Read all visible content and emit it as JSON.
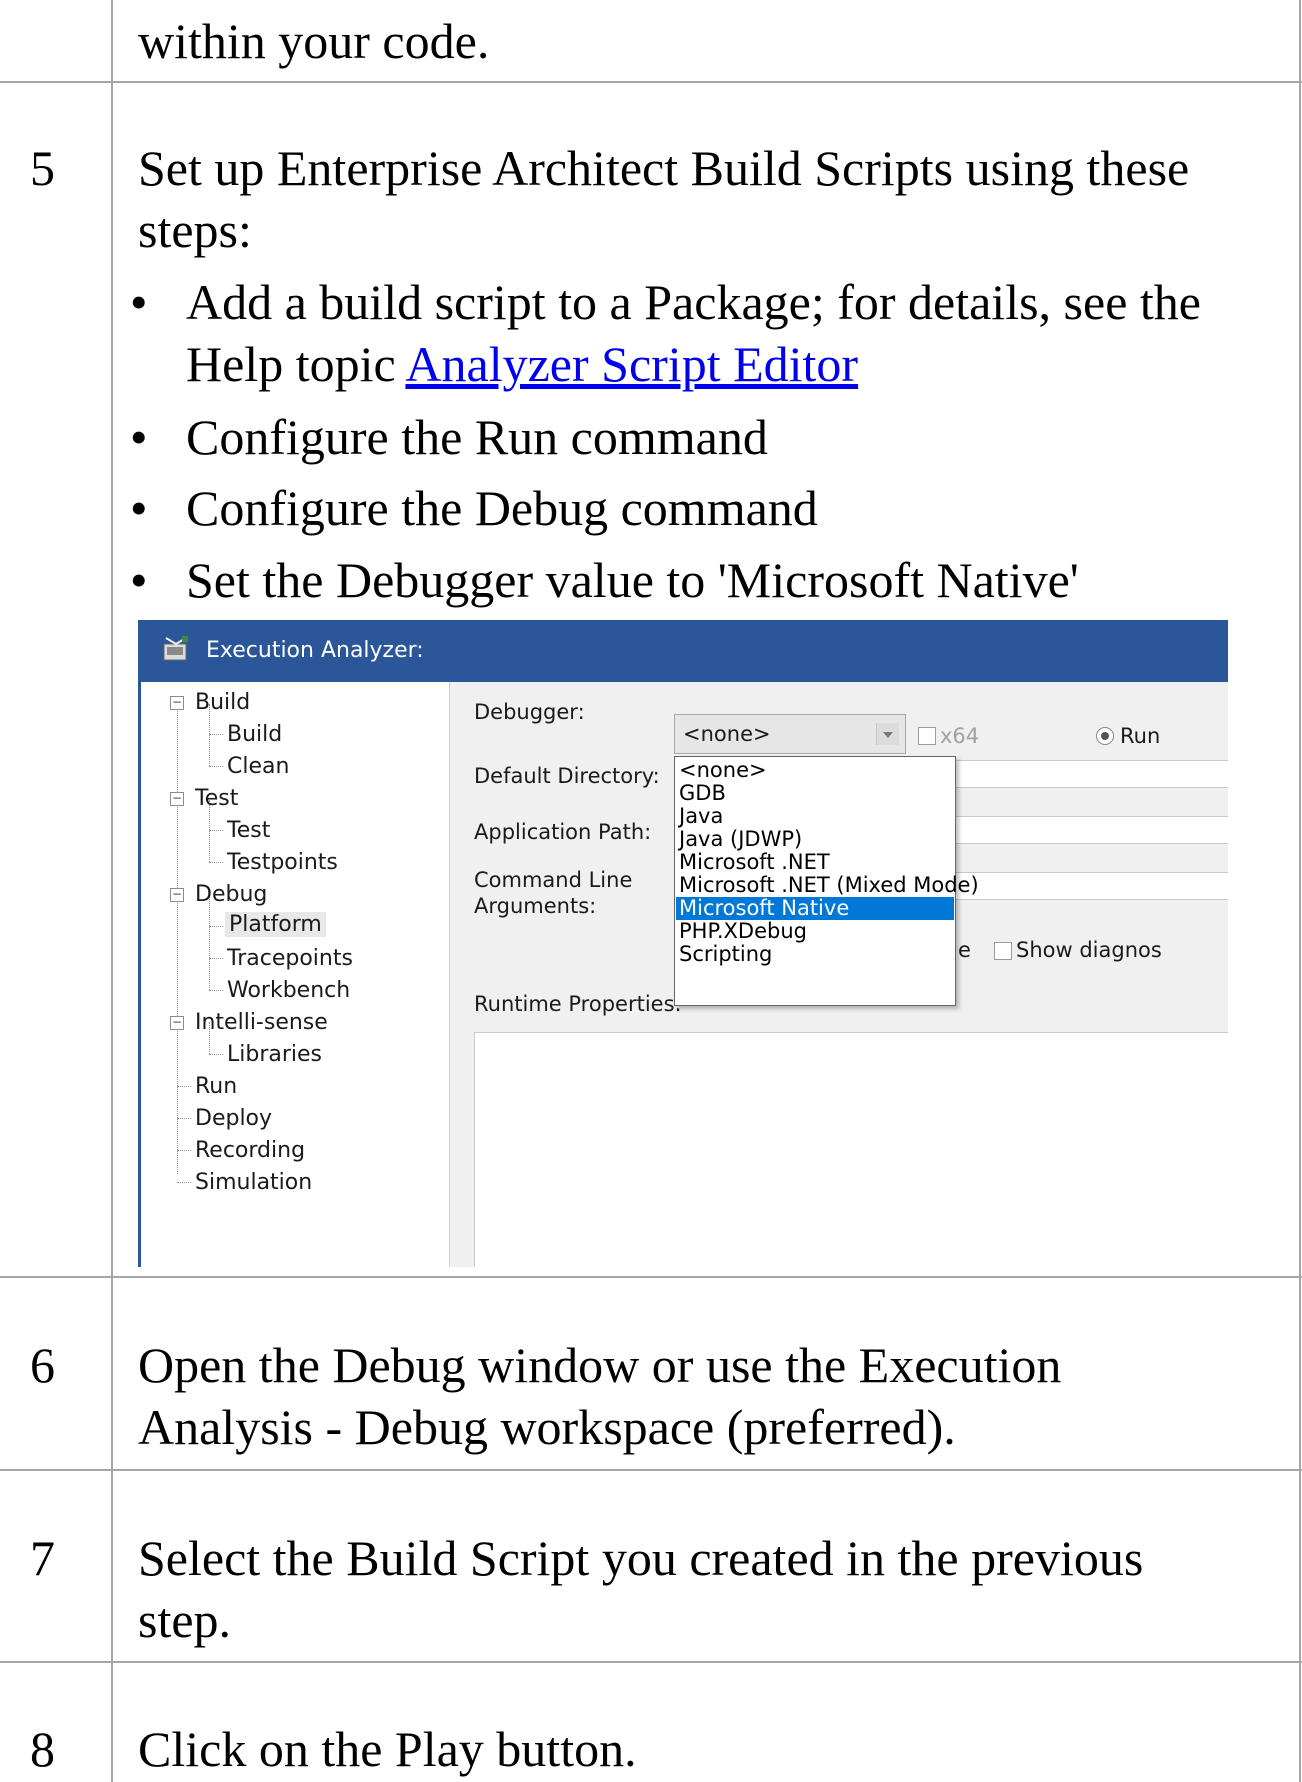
{
  "rows": [
    {
      "text_lines": [
        "within your code."
      ]
    },
    {
      "number": "5",
      "text_lines": [
        "Set up Enterprise Architect Build Scripts using these",
        "steps:"
      ],
      "bullets": [
        {
          "lines": [
            "Add a build script to a Package; for details, see the",
            "Help topic "
          ],
          "link": "Analyzer Script Editor"
        },
        {
          "lines": [
            "Configure the Run command"
          ]
        },
        {
          "lines": [
            "Configure the Debug command"
          ]
        },
        {
          "lines": [
            "Set the Debugger value to 'Microsoft Native'"
          ]
        }
      ]
    },
    {
      "number": "6",
      "text_lines": [
        "Open the Debug window or use the Execution",
        "Analysis - Debug workspace (preferred)."
      ]
    },
    {
      "number": "7",
      "text_lines": [
        "Select the Build Script you created in the previous",
        "step."
      ]
    },
    {
      "number": "8",
      "text_lines": [
        "Click on the Play button."
      ]
    }
  ],
  "screenshot": {
    "title": "Execution Analyzer:",
    "tree": [
      "Build",
      "Build",
      "Clean",
      "Test",
      "Test",
      "Testpoints",
      "Debug",
      "Platform",
      "Tracepoints",
      "Workbench",
      "Intelli-sense",
      "Libraries",
      "Run",
      "Deploy",
      "Recording",
      "Simulation"
    ],
    "labels": {
      "debugger": "Debugger:",
      "default_directory": "Default Directory:",
      "application_path": "Application Path:",
      "command_line_1": "Command Line",
      "command_line_2": "Arguments:",
      "runtime_properties": "Runtime Properties:",
      "x64": "x64",
      "run": "Run",
      "show_diagnostics": "Show diagnos",
      "partial_e": "e"
    },
    "debugger_value": "<none>",
    "dropdown_options": [
      "<none>",
      "GDB",
      "Java",
      "Java (JDWP)",
      "Microsoft .NET",
      "Microsoft .NET (Mixed Mode)",
      "Microsoft Native",
      "PHP.XDebug",
      "Scripting"
    ],
    "dropdown_selected": "Microsoft Native",
    "colors": {
      "titlebar": "#2b579a",
      "selection": "#0078d7",
      "link": "#0000ee"
    }
  }
}
